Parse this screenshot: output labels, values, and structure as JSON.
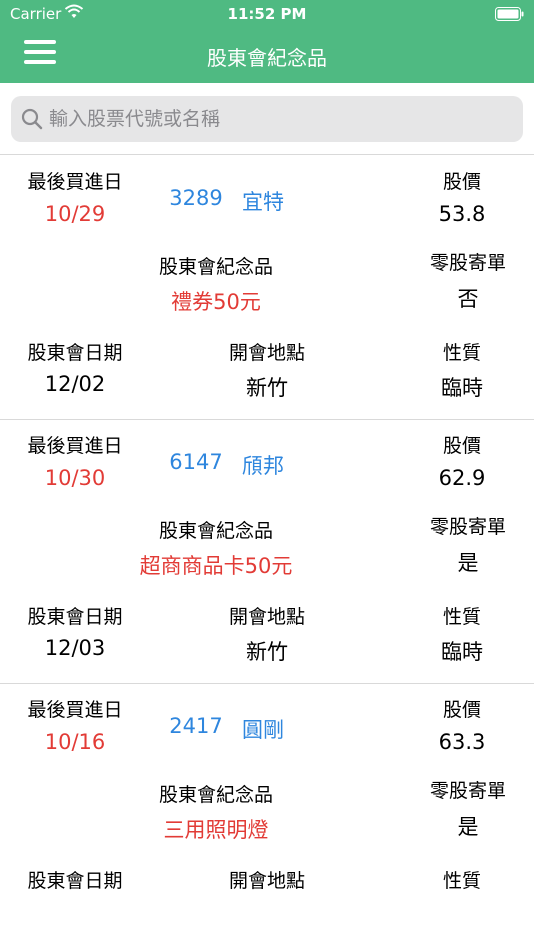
{
  "status_bar": {
    "carrier": "Carrier",
    "time": "11:52 PM"
  },
  "header": {
    "title": "股東會紀念品"
  },
  "search": {
    "placeholder": "輸入股票代號或名稱",
    "value": ""
  },
  "labels": {
    "last_buy_date": "最後買進日",
    "price": "股價",
    "souvenir": "股東會紀念品",
    "odd_lot": "零股寄單",
    "meeting_date": "股東會日期",
    "location": "開會地點",
    "type": "性質"
  },
  "items": [
    {
      "last_buy_date": "10/29",
      "code": "3289",
      "name": "宜特",
      "price": "53.8",
      "souvenir": "禮券50元",
      "odd_lot": "否",
      "meeting_date": "12/02",
      "location": "新竹",
      "type": "臨時"
    },
    {
      "last_buy_date": "10/30",
      "code": "6147",
      "name": "頎邦",
      "price": "62.9",
      "souvenir": "超商商品卡50元",
      "odd_lot": "是",
      "meeting_date": "12/03",
      "location": "新竹",
      "type": "臨時"
    },
    {
      "last_buy_date": "10/16",
      "code": "2417",
      "name": "圓剛",
      "price": "63.3",
      "souvenir": "三用照明燈",
      "odd_lot": "是"
    }
  ],
  "colors": {
    "header": "#4fba82",
    "red": "#e23b36",
    "blue": "#2e86de"
  }
}
